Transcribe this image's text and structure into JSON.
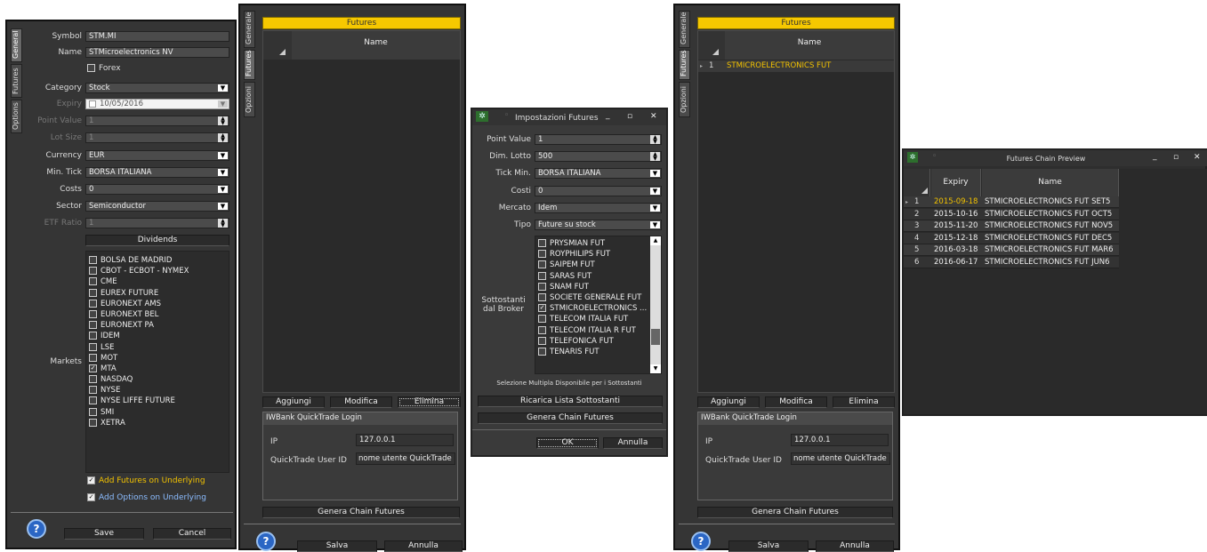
{
  "p1": {
    "tabs": [
      "General",
      "Futures",
      "Options"
    ],
    "labels": {
      "symbol": "Symbol",
      "name": "Name",
      "category": "Category",
      "expiry": "Expiry",
      "point_value": "Point Value",
      "lot_size": "Lot Size",
      "currency": "Currency",
      "min_tick": "Min. Tick",
      "costs": "Costs",
      "sector": "Sector",
      "etf_ratio": "ETF Ratio",
      "markets": "Markets"
    },
    "values": {
      "symbol": "STM.MI",
      "name": "STMicroelectronics NV",
      "forex": "Forex",
      "category": "Stock",
      "expiry": "10/05/2016",
      "point_value": "1",
      "lot_size": "1",
      "currency": "EUR",
      "min_tick": "BORSA ITALIANA",
      "costs": "0",
      "sector": "Semiconductor",
      "etf_ratio": "1"
    },
    "dividends_label": "Dividends",
    "markets": [
      {
        "name": "BOLSA DE MADRID",
        "checked": false
      },
      {
        "name": "CBOT - ECBOT - NYMEX",
        "checked": false
      },
      {
        "name": "CME",
        "checked": false
      },
      {
        "name": "EUREX FUTURE",
        "checked": false
      },
      {
        "name": "EURONEXT AMS",
        "checked": false
      },
      {
        "name": "EURONEXT BEL",
        "checked": false
      },
      {
        "name": "EURONEXT PA",
        "checked": false
      },
      {
        "name": "IDEM",
        "checked": false
      },
      {
        "name": "LSE",
        "checked": false
      },
      {
        "name": "MOT",
        "checked": false
      },
      {
        "name": "MTA",
        "checked": true
      },
      {
        "name": "NASDAQ",
        "checked": false
      },
      {
        "name": "NYSE",
        "checked": false
      },
      {
        "name": "NYSE LIFFE FUTURE",
        "checked": false
      },
      {
        "name": "SMI",
        "checked": false
      },
      {
        "name": "XETRA",
        "checked": false
      }
    ],
    "add_futures": "Add Futures on Underlying",
    "add_options": "Add Options on Underlying",
    "save": "Save",
    "cancel": "Cancel",
    "help": "?"
  },
  "p2": {
    "tabs": [
      "Generale",
      "Futures",
      "Opzioni"
    ],
    "header": "Futures",
    "col_name": "Name",
    "btn_add": "Aggiungi",
    "btn_edit": "Modifica",
    "btn_delete": "Elimina",
    "login_title": "IWBank QuickTrade Login",
    "ip_label": "IP",
    "ip_value": "127.0.0.1",
    "user_label": "QuickTrade User ID",
    "user_value": "nome utente QuickTrade",
    "gen_chain": "Genera Chain Futures",
    "save": "Salva",
    "cancel": "Annulla",
    "help": "?"
  },
  "dlg": {
    "title": "Impostazioni Futures",
    "labels": {
      "point_value": "Point Value",
      "lot": "Dim. Lotto",
      "tick": "Tick Min.",
      "costs": "Costi",
      "market": "Mercato",
      "type": "Tipo",
      "underlying": "Sottostanti dal Broker"
    },
    "values": {
      "point_value": "1",
      "lot": "500",
      "tick": "BORSA ITALIANA",
      "costs": "0",
      "market": "Idem",
      "type": "Future su stock"
    },
    "items": [
      {
        "name": "PRYSMIAN FUT",
        "checked": false
      },
      {
        "name": "ROYPHILIPS FUT",
        "checked": false
      },
      {
        "name": "SAIPEM FUT",
        "checked": false
      },
      {
        "name": "SARAS FUT",
        "checked": false
      },
      {
        "name": "SNAM FUT",
        "checked": false
      },
      {
        "name": "SOCIETE GENERALE FUT",
        "checked": false
      },
      {
        "name": "STMICROELECTRONICS ...",
        "checked": true
      },
      {
        "name": "TELECOM ITALIA FUT",
        "checked": false
      },
      {
        "name": "TELECOM ITALIA R FUT",
        "checked": false
      },
      {
        "name": "TELEFONICA FUT",
        "checked": false
      },
      {
        "name": "TENARIS FUT",
        "checked": false
      }
    ],
    "hint": "Selezione Multipla Disponibile per i Sottostanti",
    "reload": "Ricarica Lista Sottostanti",
    "gen_chain": "Genera Chain Futures",
    "ok": "OK",
    "cancel": "Annulla"
  },
  "p3": {
    "tabs": [
      "Generale",
      "Futures",
      "Opzioni"
    ],
    "header": "Futures",
    "col_name": "Name",
    "row_num": "1",
    "row_name": "STMICROELECTRONICS FUT",
    "btn_add": "Aggiungi",
    "btn_edit": "Modifica",
    "btn_delete": "Elimina",
    "login_title": "IWBank QuickTrade Login",
    "ip_label": "IP",
    "ip_value": "127.0.0.1",
    "user_label": "QuickTrade User ID",
    "user_value": "nome utente QuickTrade",
    "gen_chain": "Genera Chain Futures",
    "save": "Salva",
    "cancel": "Annulla",
    "help": "?"
  },
  "preview": {
    "title": "Futures Chain Preview",
    "col_expiry": "Expiry",
    "col_name": "Name",
    "rows": [
      {
        "n": "1",
        "expiry": "2015-09-18",
        "name": "STMICROELECTRONICS FUT SET5"
      },
      {
        "n": "2",
        "expiry": "2015-10-16",
        "name": "STMICROELECTRONICS FUT OCT5"
      },
      {
        "n": "3",
        "expiry": "2015-11-20",
        "name": "STMICROELECTRONICS FUT NOV5"
      },
      {
        "n": "4",
        "expiry": "2015-12-18",
        "name": "STMICROELECTRONICS FUT DEC5"
      },
      {
        "n": "5",
        "expiry": "2016-03-18",
        "name": "STMICROELECTRONICS FUT MAR6"
      },
      {
        "n": "6",
        "expiry": "2016-06-17",
        "name": "STMICROELECTRONICS FUT JUN6"
      }
    ]
  },
  "colors": {
    "accent_yellow": "#f6c800",
    "panel_bg": "#353535",
    "link_blue": "#8bbcff"
  }
}
